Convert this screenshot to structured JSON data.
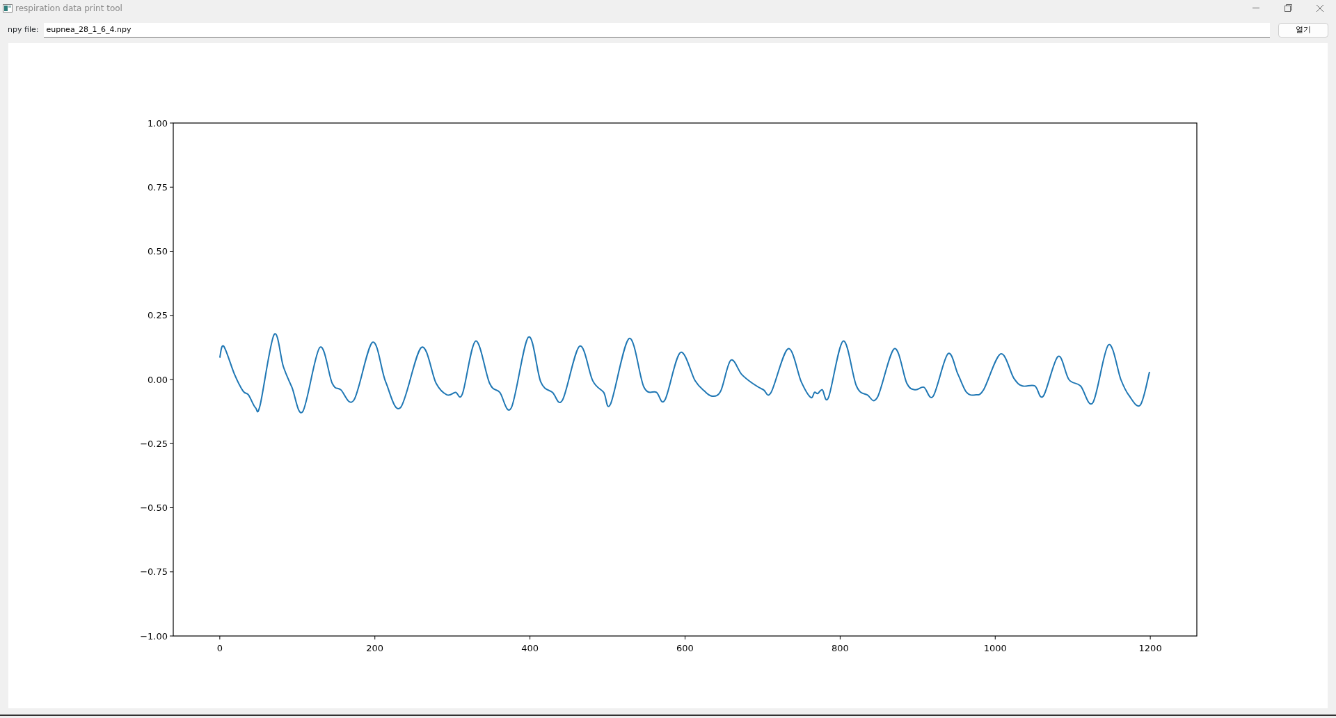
{
  "window": {
    "title": "respiration data print tool"
  },
  "file_row": {
    "label": "npy file:",
    "value": "eupnea_28_1_6_4.npy",
    "button": "열기"
  },
  "chart_data": {
    "type": "line",
    "xlim": [
      -60,
      1260
    ],
    "ylim": [
      -1,
      1
    ],
    "xticks": [
      0,
      200,
      400,
      600,
      800,
      1000,
      1200
    ],
    "yticks": [
      {
        "value": 1,
        "label": "1.00"
      },
      {
        "value": 0.75,
        "label": "0.75"
      },
      {
        "value": 0.5,
        "label": "0.50"
      },
      {
        "value": 0.25,
        "label": "0.25"
      },
      {
        "value": 0,
        "label": "0.00"
      },
      {
        "value": -0.25,
        "label": "−0.25"
      },
      {
        "value": -0.5,
        "label": "−0.50"
      },
      {
        "value": -0.75,
        "label": "−0.75"
      },
      {
        "value": -1,
        "label": "−1.00"
      }
    ],
    "x": [
      0,
      5,
      19,
      30,
      37,
      46,
      52,
      70,
      82,
      93,
      107,
      129,
      145,
      156,
      173,
      197,
      214,
      233,
      260,
      279,
      293,
      304,
      313,
      330,
      348,
      361,
      376,
      398,
      414,
      429,
      442,
      464,
      481,
      495,
      504,
      528,
      547,
      563,
      574,
      594,
      613,
      625,
      635,
      646,
      659,
      673,
      687,
      701,
      711,
      733,
      750,
      762,
      767,
      771,
      777,
      785,
      804,
      821,
      835,
      848,
      870,
      886,
      897,
      908,
      920,
      939,
      952,
      963,
      974,
      985,
      1007,
      1024,
      1035,
      1051,
      1062,
      1081,
      1095,
      1110,
      1126,
      1146,
      1162,
      1172,
      1187,
      1199
    ],
    "series": [
      {
        "color": "#1f77b4",
        "values": [
          0.085,
          0.13,
          0.02,
          -0.045,
          -0.06,
          -0.11,
          -0.1,
          0.175,
          0.05,
          -0.03,
          -0.125,
          0.125,
          -0.015,
          -0.04,
          -0.08,
          0.145,
          -0.01,
          -0.11,
          0.125,
          -0.015,
          -0.06,
          -0.05,
          -0.055,
          0.15,
          -0.015,
          -0.05,
          -0.11,
          0.165,
          -0.01,
          -0.05,
          -0.08,
          0.13,
          -0.005,
          -0.05,
          -0.095,
          0.16,
          -0.03,
          -0.05,
          -0.08,
          0.105,
          -0.005,
          -0.045,
          -0.065,
          -0.045,
          0.075,
          0.02,
          -0.015,
          -0.04,
          -0.05,
          0.12,
          -0.01,
          -0.07,
          -0.05,
          -0.055,
          -0.04,
          -0.07,
          0.15,
          -0.025,
          -0.06,
          -0.07,
          0.12,
          -0.015,
          -0.04,
          -0.03,
          -0.065,
          0.1,
          0.02,
          -0.05,
          -0.06,
          -0.04,
          0.1,
          0.005,
          -0.025,
          -0.025,
          -0.065,
          0.09,
          0.0,
          -0.025,
          -0.09,
          0.135,
          0.0,
          -0.06,
          -0.1,
          0.03
        ]
      }
    ]
  }
}
